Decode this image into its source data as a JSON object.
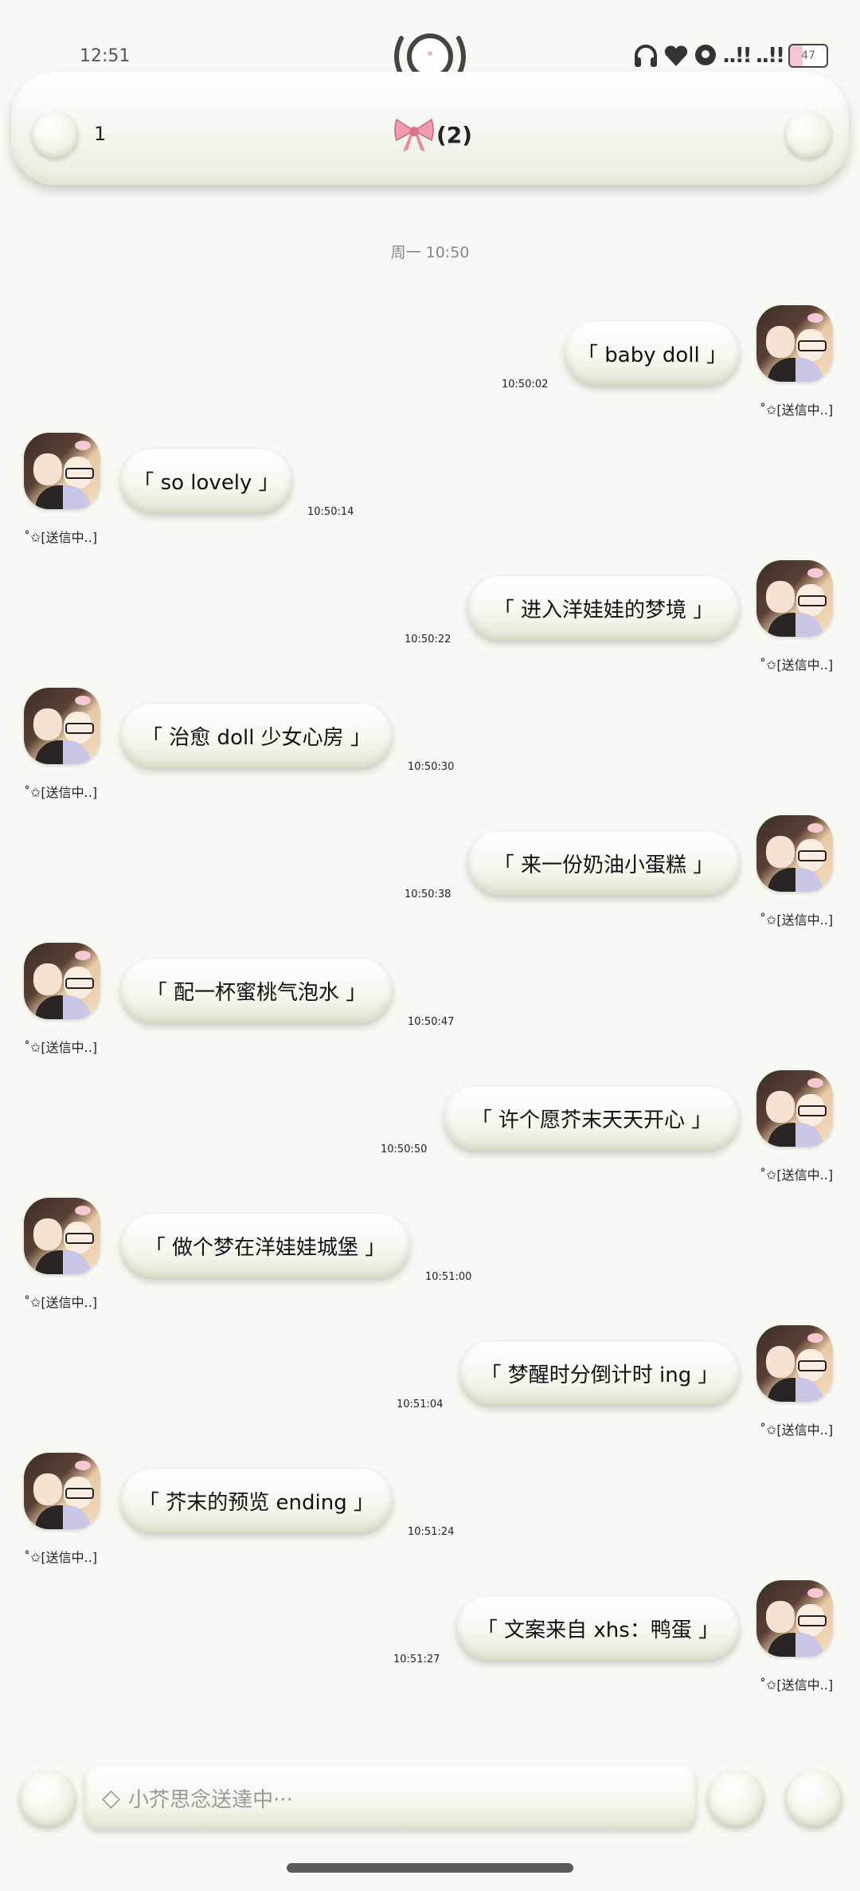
{
  "status_bar": {
    "time": "12:51",
    "center_icon": "record-indicator-icon",
    "icons": [
      "headphones-icon",
      "heart-icon",
      "location-icon",
      "signal-icon",
      "signal-icon"
    ],
    "signal_text": "..!!",
    "battery": "47"
  },
  "header": {
    "left_count": "1",
    "title_icon": "pink-bow-icon",
    "title": "(2)",
    "left_button": "bubble-button",
    "right_button": "bubble-button"
  },
  "date_divider": "周一 10:50",
  "status_text": "˚✩[送信中..]",
  "messages": [
    {
      "side": "right",
      "text": "「 baby doll 」",
      "time": "10:50:02"
    },
    {
      "side": "left",
      "text": "「 so lovely 」",
      "time": "10:50:14"
    },
    {
      "side": "right",
      "text": "「 进入洋娃娃的梦境 」",
      "time": "10:50:22"
    },
    {
      "side": "left",
      "text": "「 治愈 doll 少女心房 」",
      "time": "10:50:30"
    },
    {
      "side": "right",
      "text": "「 来一份奶油小蛋糕 」",
      "time": "10:50:38"
    },
    {
      "side": "left",
      "text": "「 配一杯蜜桃气泡水 」",
      "time": "10:50:47"
    },
    {
      "side": "right",
      "text": "「 许个愿芥末天天开心 」",
      "time": "10:50:50"
    },
    {
      "side": "left",
      "text": "「 做个梦在洋娃娃城堡 」",
      "time": "10:51:00"
    },
    {
      "side": "right",
      "text": "「 梦醒时分倒计时 ing 」",
      "time": "10:51:04"
    },
    {
      "side": "left",
      "text": "「 芥末的预览 ending 」",
      "time": "10:51:24"
    },
    {
      "side": "right",
      "text": "「 文案来自 xhs：鸭蛋 」",
      "time": "10:51:27"
    }
  ],
  "input_bar": {
    "icon": "diamond-outline-icon",
    "placeholder": "小芥思念送達中···"
  },
  "colors": {
    "background": "#f8f9f2",
    "bubble_light": "#ffffff",
    "bubble_shade": "#e6e9d8",
    "bow_pink": "#e88aa0"
  }
}
